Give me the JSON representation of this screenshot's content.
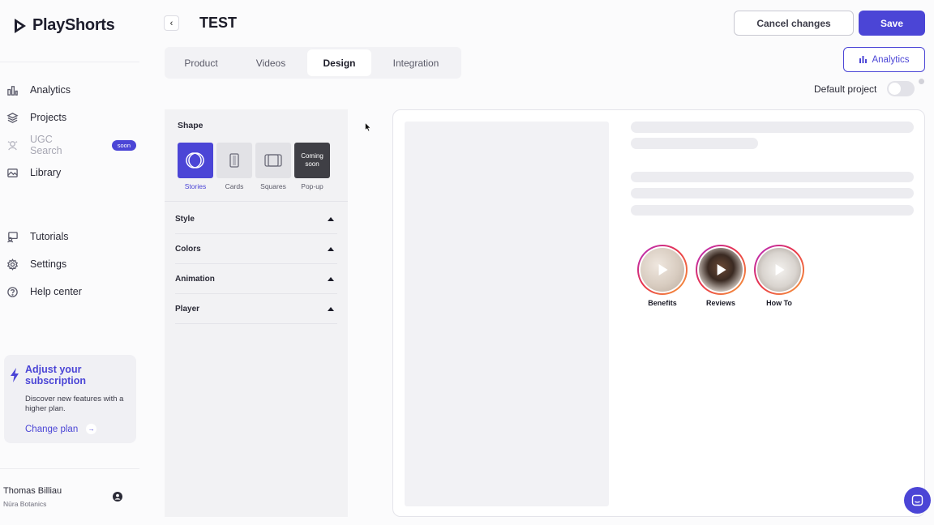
{
  "brand": {
    "name": "PlayShorts",
    "accent": "#4b45d6"
  },
  "sidebar": {
    "items": [
      {
        "label": "Analytics",
        "icon": "bar-chart-icon"
      },
      {
        "label": "Projects",
        "icon": "layers-icon"
      },
      {
        "label": "UGC Search",
        "icon": "ugc-search-icon",
        "badge": "soon",
        "disabled": true
      },
      {
        "label": "Library",
        "icon": "image-icon"
      },
      {
        "label": "Tutorials",
        "icon": "tutorials-icon"
      },
      {
        "label": "Settings",
        "icon": "gear-icon"
      },
      {
        "label": "Help center",
        "icon": "help-icon"
      }
    ],
    "promo": {
      "title": "Adjust your subscription",
      "description": "Discover new features with a higher plan.",
      "link": "Change plan"
    },
    "user": {
      "name": "Thomas Billiau",
      "org": "Nūra Botanics"
    }
  },
  "header": {
    "back": "‹",
    "title": "TEST",
    "cancel_label": "Cancel changes",
    "save_label": "Save",
    "analytics_label": "Analytics"
  },
  "tabs": [
    {
      "label": "Product",
      "active": false
    },
    {
      "label": "Videos",
      "active": false
    },
    {
      "label": "Design",
      "active": true
    },
    {
      "label": "Integration",
      "active": false
    }
  ],
  "default_project": {
    "label": "Default project",
    "enabled": false
  },
  "design_panel": {
    "shape_heading": "Shape",
    "shapes": [
      {
        "label": "Stories",
        "selected": true
      },
      {
        "label": "Cards",
        "selected": false
      },
      {
        "label": "Squares",
        "selected": false
      },
      {
        "label": "Pop-up",
        "selected": false,
        "overlay": "Coming soon"
      }
    ],
    "sections": [
      "Style",
      "Colors",
      "Animation",
      "Player"
    ]
  },
  "preview": {
    "stories": [
      {
        "label": "Benefits"
      },
      {
        "label": "Reviews"
      },
      {
        "label": "How To"
      }
    ]
  }
}
